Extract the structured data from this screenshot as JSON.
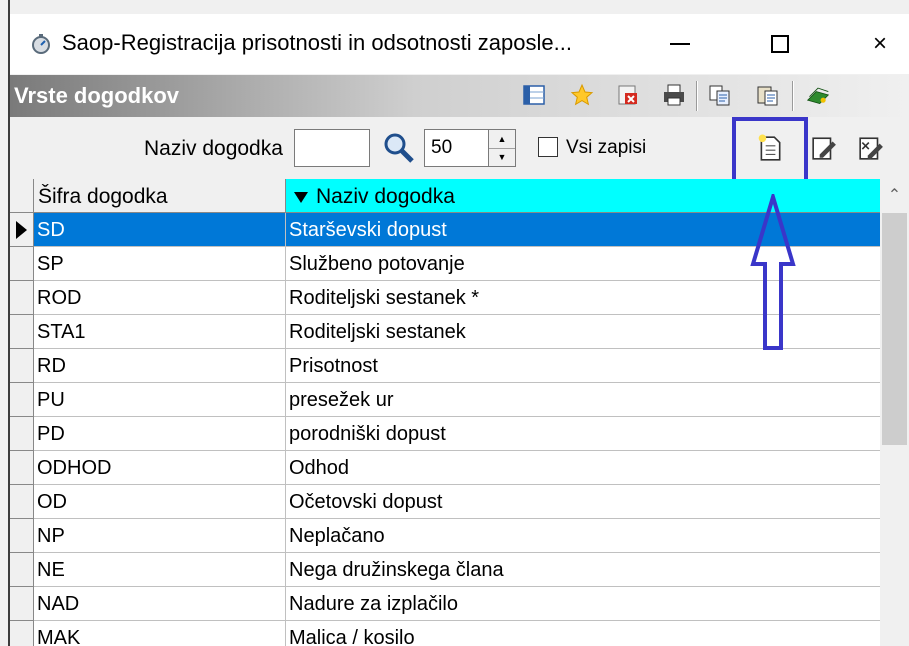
{
  "window": {
    "title": "Saop-Registracija prisotnosti in odsotnosti zaposle...",
    "app_icon": "stopwatch-icon",
    "controls": {
      "minimize": "minimize-icon",
      "maximize": "maximize-icon",
      "close": "×"
    }
  },
  "panel": {
    "title": "Vrste dogodkov",
    "toolbar_icons": [
      "columns-icon",
      "star-icon",
      "excel-export-icon",
      "print-icon",
      "copy-icon",
      "paste-icon",
      "exit-icon"
    ]
  },
  "filter": {
    "label": "Naziv dogodka",
    "value": "",
    "count": "50",
    "all_records_label": "Vsi zapisi",
    "all_records_checked": false,
    "action_icons": [
      "new-record-icon",
      "edit-record-icon",
      "edit-all-icon"
    ]
  },
  "grid": {
    "columns": [
      "Šifra dogodka",
      "Naziv dogodka"
    ],
    "sort_column": "Naziv dogodka",
    "selected_index": 0,
    "rows": [
      {
        "code": "SD",
        "name": "Starševski dopust"
      },
      {
        "code": "SP",
        "name": "Službeno potovanje"
      },
      {
        "code": "ROD",
        "name": "Roditeljski sestanek *"
      },
      {
        "code": "STA1",
        "name": "Roditeljski sestanek"
      },
      {
        "code": "RD",
        "name": "Prisotnost"
      },
      {
        "code": "PU",
        "name": "presežek ur"
      },
      {
        "code": "PD",
        "name": "porodniški dopust"
      },
      {
        "code": "ODHOD",
        "name": "Odhod"
      },
      {
        "code": "OD",
        "name": "Očetovski dopust"
      },
      {
        "code": "NP",
        "name": "Neplačano"
      },
      {
        "code": "NE",
        "name": "Nega družinskega člana"
      },
      {
        "code": "NAD",
        "name": "Nadure za izplačilo"
      },
      {
        "code": "MAK",
        "name": "Malica / kosilo"
      }
    ]
  },
  "colors": {
    "selection": "#0078d7",
    "sorted_header": "#00ffff",
    "annotation": "#3a36c9"
  }
}
